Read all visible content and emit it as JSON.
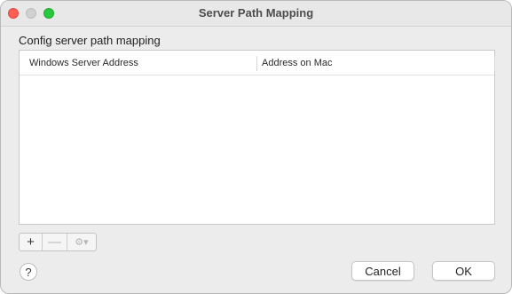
{
  "window": {
    "title": "Server Path Mapping"
  },
  "section": {
    "label": "Config server path mapping"
  },
  "table": {
    "columns": [
      "Windows Server Address",
      "Address on Mac"
    ],
    "rows": []
  },
  "toolbar": {
    "add_icon": "plus-icon",
    "add_label": "+",
    "remove_icon": "minus-icon",
    "remove_label": "—",
    "gear_icon": "gear-icon",
    "gear_label": "⚙▾"
  },
  "help": {
    "label": "?"
  },
  "buttons": {
    "cancel": "Cancel",
    "ok": "OK"
  },
  "colors": {
    "close": "#fe5f57",
    "minimize_inactive": "#d0d0d0",
    "maximize": "#28c840"
  }
}
